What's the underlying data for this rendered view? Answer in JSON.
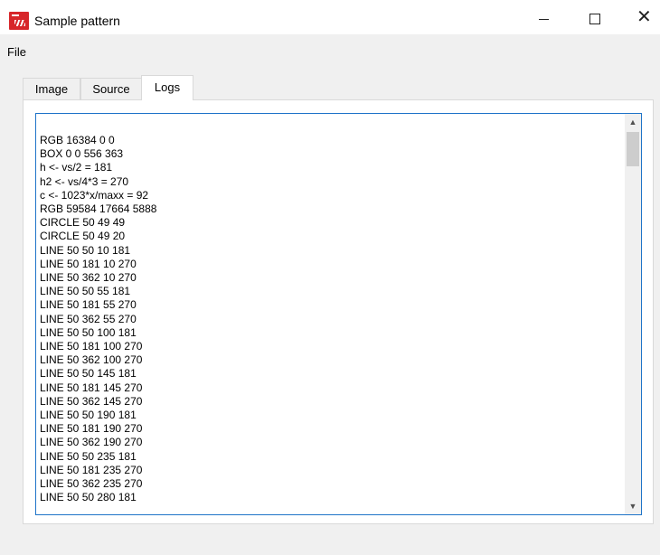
{
  "window": {
    "title": "Sample pattern",
    "icon": "app-logo-icon",
    "controls": {
      "minimize": "minimize-icon",
      "maximize": "maximize-icon",
      "close": "close-icon",
      "close_glyph": "✕"
    }
  },
  "menubar": {
    "file": "File"
  },
  "tabs": [
    {
      "label": "Image"
    },
    {
      "label": "Source"
    },
    {
      "label": "Logs",
      "selected": true
    }
  ],
  "logs": {
    "lines": [
      "RGB 16384 0 0",
      "BOX 0 0 556 363",
      "h <- vs/2 = 181",
      "h2 <- vs/4*3 = 270",
      "c <- 1023*x/maxx = 92",
      "RGB 59584 17664 5888",
      "CIRCLE 50 49 49",
      "CIRCLE 50 49 20",
      "LINE 50 50 10 181",
      "LINE 50 181 10 270",
      "LINE 50 362 10 270",
      "LINE 50 50 55 181",
      "LINE 50 181 55 270",
      "LINE 50 362 55 270",
      "LINE 50 50 100 181",
      "LINE 50 181 100 270",
      "LINE 50 362 100 270",
      "LINE 50 50 145 181",
      "LINE 50 181 145 270",
      "LINE 50 362 145 270",
      "LINE 50 50 190 181",
      "LINE 50 181 190 270",
      "LINE 50 362 190 270",
      "LINE 50 50 235 181",
      "LINE 50 181 235 270",
      "LINE 50 362 235 270",
      "LINE 50 50 280 181"
    ],
    "scroll_up_glyph": "▲",
    "scroll_down_glyph": "▼"
  },
  "colors": {
    "accent": "#1e73c8",
    "brand": "#d7262a"
  }
}
